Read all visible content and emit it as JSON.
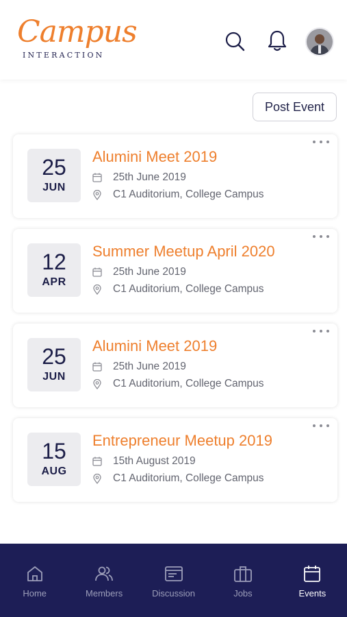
{
  "header": {
    "logo_script": "Campus",
    "logo_sub": "INTERACTION"
  },
  "toolbar": {
    "post_event_label": "Post Event"
  },
  "events": [
    {
      "day": "25",
      "month": "JUN",
      "title": "Alumini Meet 2019",
      "date_text": "25th June 2019",
      "location": "C1 Auditorium, College Campus"
    },
    {
      "day": "12",
      "month": "APR",
      "title": "Summer Meetup April 2020",
      "date_text": "25th June 2019",
      "location": "C1 Auditorium, College Campus"
    },
    {
      "day": "25",
      "month": "JUN",
      "title": "Alumini Meet 2019",
      "date_text": "25th June 2019",
      "location": "C1 Auditorium, College Campus"
    },
    {
      "day": "15",
      "month": "AUG",
      "title": "Entrepreneur Meetup 2019",
      "date_text": "15th August 2019",
      "location": "C1 Auditorium, College Campus"
    }
  ],
  "nav": {
    "items": [
      {
        "label": "Home",
        "icon": "home-icon",
        "active": false
      },
      {
        "label": "Members",
        "icon": "members-icon",
        "active": false
      },
      {
        "label": "Discussion",
        "icon": "discussion-icon",
        "active": false
      },
      {
        "label": "Jobs",
        "icon": "briefcase-icon",
        "active": false
      },
      {
        "label": "Events",
        "icon": "calendar-icon",
        "active": true
      }
    ]
  },
  "colors": {
    "accent": "#ee7f2d",
    "nav_bg": "#1d1e56",
    "text_dark": "#1b1d47"
  }
}
